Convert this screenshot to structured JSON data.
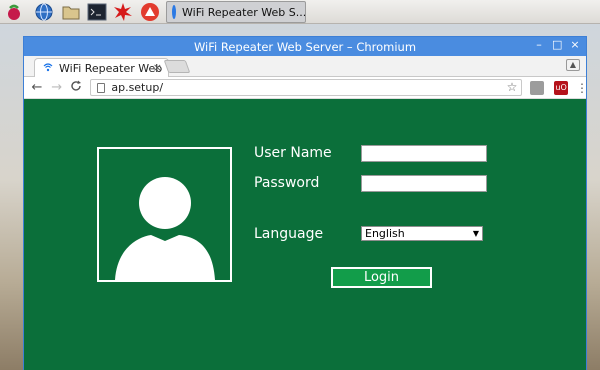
{
  "taskbar": {
    "icons": [
      "raspberry-icon",
      "globe-icon",
      "folder-icon",
      "terminal-icon",
      "burst-icon",
      "wolfram-icon"
    ],
    "active_task_label": "WiFi Repeater Web S..."
  },
  "window": {
    "title": "WiFi Repeater Web Server – Chromium",
    "controls": [
      "–",
      "□",
      "×"
    ]
  },
  "tab": {
    "label": "WiFi Repeater Web",
    "close": "×"
  },
  "toolbar": {
    "back": "←",
    "forward": "→",
    "reload": "C",
    "url": "ap.setup/",
    "star": "☆",
    "menu": "⋮"
  },
  "login_form": {
    "username_label": "User Name",
    "username_value": "",
    "password_label": "Password",
    "password_value": "",
    "language_label": "Language",
    "language_selected": "English",
    "login_button": "Login"
  },
  "colors": {
    "page_bg": "#0b6f3a",
    "button_bg": "#129d4a",
    "titlebar": "#4a8ce0"
  }
}
